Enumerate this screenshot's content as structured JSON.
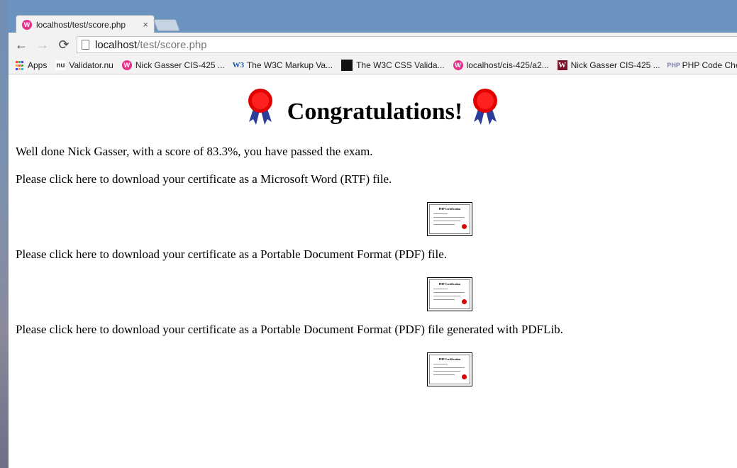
{
  "browser": {
    "tab_title": "localhost/test/score.php",
    "tab_close": "×",
    "url_host": "localhost",
    "url_path": "/test/score.php",
    "back_icon": "←",
    "forward_icon": "→",
    "reload_icon": "⟳",
    "wamp_glyph": "W"
  },
  "bookmarks": [
    {
      "label": "Apps",
      "icon": "apps-grid-icon"
    },
    {
      "label": "Validator.nu",
      "icon": "validator-nu-icon"
    },
    {
      "label": "Nick Gasser CIS-425 ...",
      "icon": "wamp-icon"
    },
    {
      "label": "The W3C Markup Va...",
      "icon": "w3c-icon"
    },
    {
      "label": "The W3C CSS Valida...",
      "icon": "css-validator-icon"
    },
    {
      "label": "localhost/cis-425/a2...",
      "icon": "wamp-icon"
    },
    {
      "label": "Nick Gasser CIS-425 ...",
      "icon": "w-logo-icon"
    },
    {
      "label": "PHP Code Check",
      "icon": "php-icon"
    }
  ],
  "icon_glyphs": {
    "vnu": "nu",
    "w3": "W3",
    "w": "W",
    "php": "PHP"
  },
  "page": {
    "title": "Congratulations!",
    "message": "Well done Nick Gasser, with a score of 83.3%, you have passed the exam.",
    "downloads": [
      {
        "text": "Please click here to download your certificate as a Microsoft Word (RTF) file."
      },
      {
        "text": "Please click here to download your certificate as a Portable Document Format (PDF) file."
      },
      {
        "text": "Please click here to download your certificate as a Portable Document Format (PDF) file generated with PDFLib."
      }
    ],
    "certificate_thumb_title": "PHP Certification"
  },
  "colors": {
    "ribbon_red": "#e00000",
    "ribbon_blue": "#2c3d9c",
    "tab_bg": "#6b93c0",
    "wamp_pink": "#e8318b"
  }
}
